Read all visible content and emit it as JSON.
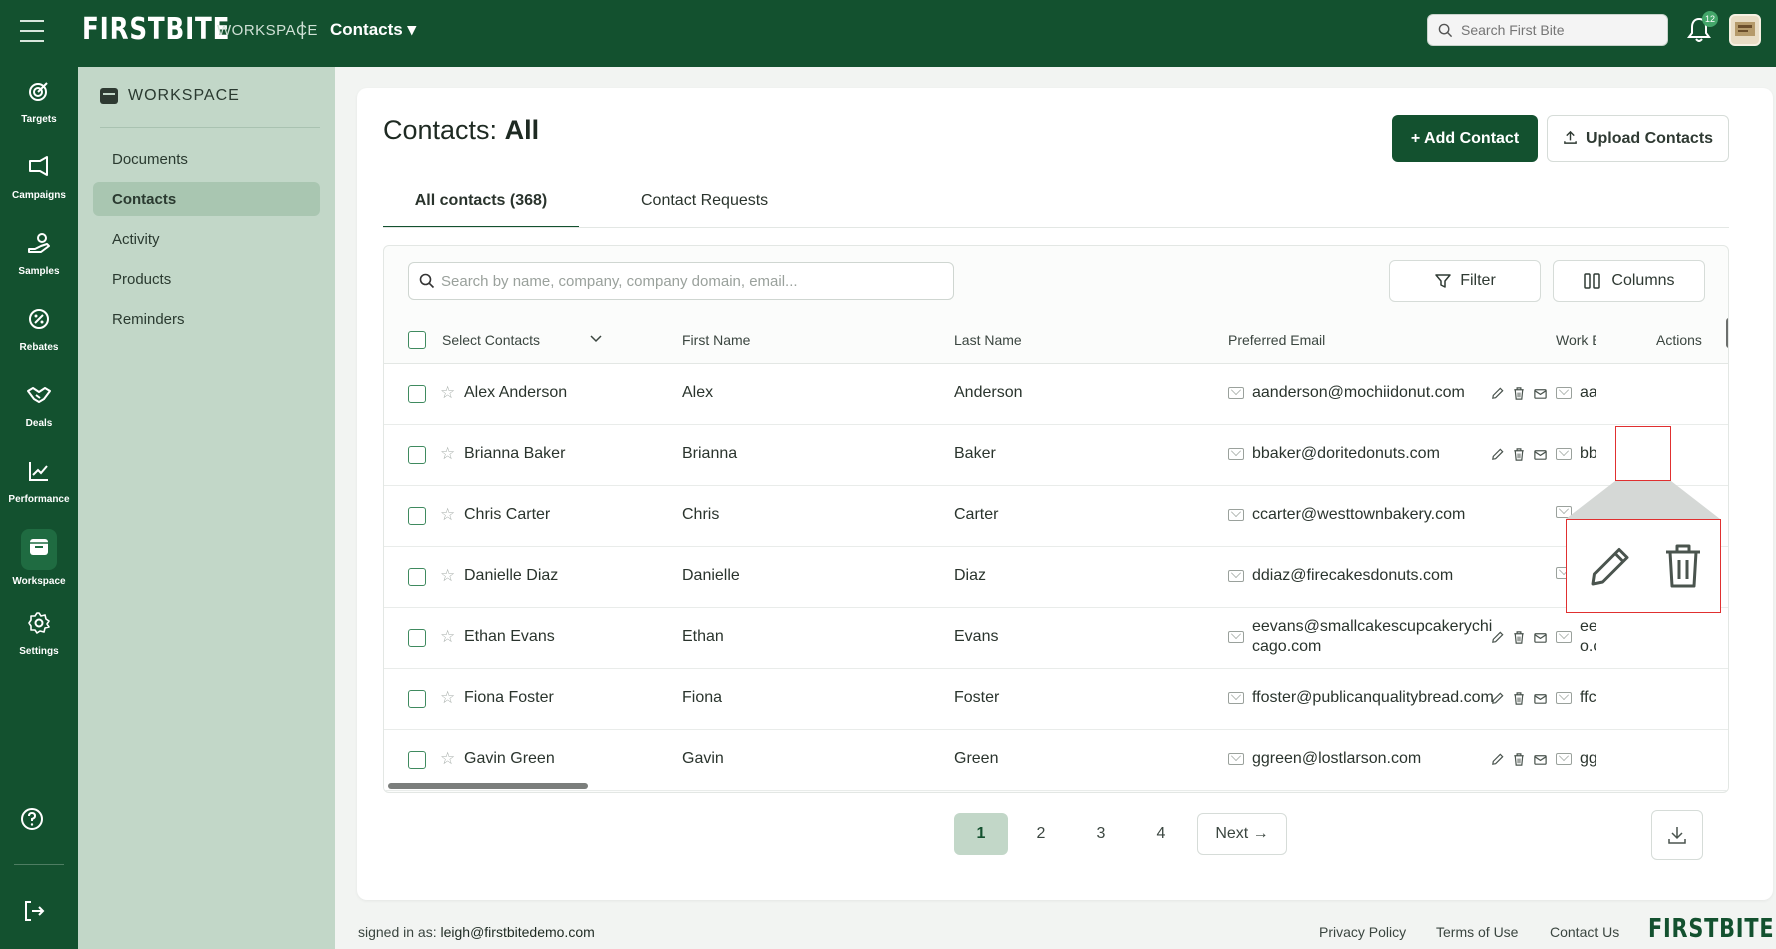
{
  "header": {
    "logo": "FIRSTBITE",
    "workspace": "WORKSPACE",
    "separator": "|",
    "current": "Contacts ▾",
    "search_placeholder": "Search First Bite",
    "notification_count": "12"
  },
  "rail": {
    "items": [
      {
        "label": "Targets",
        "icon": "target-icon"
      },
      {
        "label": "Campaigns",
        "icon": "megaphone-icon"
      },
      {
        "label": "Samples",
        "icon": "hand-sample-icon"
      },
      {
        "label": "Rebates",
        "icon": "percent-badge-icon"
      },
      {
        "label": "Deals",
        "icon": "handshake-icon"
      },
      {
        "label": "Performance",
        "icon": "chart-line-icon"
      },
      {
        "label": "Workspace",
        "icon": "archive-box-icon"
      },
      {
        "label": "Settings",
        "icon": "gear-icon"
      }
    ],
    "active": "Workspace"
  },
  "subside": {
    "title": "WORKSPACE",
    "items": [
      "Documents",
      "Contacts",
      "Activity",
      "Products",
      "Reminders"
    ],
    "active": "Contacts"
  },
  "main": {
    "title_prefix": "Contacts:",
    "title_strong": "All",
    "add_label": "+ Add Contact",
    "upload_label": "Upload Contacts",
    "tabs": [
      "All contacts (368)",
      "Contact Requests"
    ],
    "search_placeholder": "Search by name, company, company domain, email...",
    "filter_label": "Filter",
    "columns_label": "Columns",
    "columns": {
      "select": "Select Contacts",
      "first": "First Name",
      "last": "Last Name",
      "email": "Preferred Email",
      "work": "Work E",
      "actions": "Actions"
    },
    "rows": [
      {
        "name": "Alex Anderson",
        "first": "Alex",
        "last": "Anderson",
        "email": "aanderson@mochiidonut.com",
        "work": "aa"
      },
      {
        "name": "Brianna Baker",
        "first": "Brianna",
        "last": "Baker",
        "email": "bbaker@doritedonuts.com",
        "work": "bb"
      },
      {
        "name": "Chris Carter",
        "first": "Chris",
        "last": "Carter",
        "email": "ccarter@westtownbakery.com",
        "work": ""
      },
      {
        "name": "Danielle Diaz",
        "first": "Danielle",
        "last": "Diaz",
        "email": "ddiaz@firecakesdonuts.com",
        "work": ""
      },
      {
        "name": "Ethan Evans",
        "first": "Ethan",
        "last": "Evans",
        "email": "eevans@smallcakescupcakerychicago.com",
        "work": "ee o.c"
      },
      {
        "name": "Fiona Foster",
        "first": "Fiona",
        "last": "Foster",
        "email": "ffoster@publicanqualitybread.com",
        "work": "ffc"
      },
      {
        "name": "Gavin Green",
        "first": "Gavin",
        "last": "Green",
        "email": "ggreen@lostlarson.com",
        "work": "gg"
      }
    ],
    "pagination": [
      "1",
      "2",
      "3",
      "4"
    ],
    "current_page": "1",
    "next_label": "Next →"
  },
  "footer": {
    "signed_prefix": "signed in as:",
    "signed_user": "leigh@firstbitedemo.com",
    "links": [
      "Privacy Policy",
      "Terms of Use",
      "Contact Us"
    ],
    "logo": "FIRSTBITE"
  },
  "colors": {
    "brand": "#13512f",
    "sidebar": "#c2d7c8",
    "highlight": "#e03030"
  }
}
